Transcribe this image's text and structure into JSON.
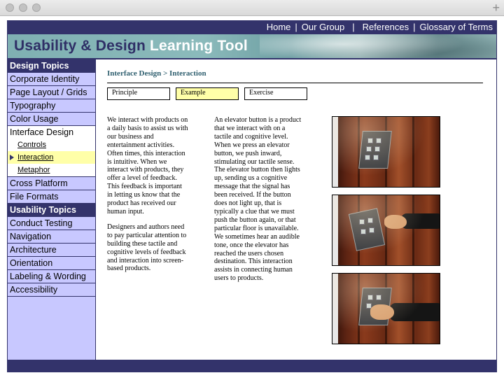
{
  "topnav": {
    "home": "Home",
    "our_group": "Our Group",
    "references": "References",
    "glossary": "Glossary of Terms",
    "sep": "|"
  },
  "banner": {
    "title_part1": "Usability & Design",
    "title_part2": "Learning Tool"
  },
  "sidebar": {
    "design_topics_heading": "Design Topics",
    "design_items": [
      "Corporate Identity",
      "Page Layout / Grids",
      "Typography",
      "Color Usage"
    ],
    "interface_design": "Interface Design",
    "sub_items": [
      "Controls",
      "Interaction",
      "Metaphor"
    ],
    "more_design_items": [
      "Cross Platform",
      "File Formats"
    ],
    "usability_topics_heading": "Usability Topics",
    "usability_items": [
      "Conduct Testing",
      "Navigation",
      "Architecture",
      "Orientation",
      "Labeling & Wording",
      "Accessibility"
    ]
  },
  "content": {
    "breadcrumb": "Interface Design > Interaction",
    "tabs": [
      "Principle",
      "Example",
      "Exercise"
    ],
    "selected_tab": "Example",
    "col1_p1": "We interact with products on a daily basis to assist us with our business and entertainment activities. Often times, this interaction is intuitive. When we interact with products, they offer a level of feedback. This feedback is important in letting us know that the product has received our human input.",
    "col1_p2": "Designers and authors need to pay particular attention to building these tactile and cognitive levels of feedback and interaction into screen-based products.",
    "col2_p1": "An elevator button is a product that we interact with on a tactile and cognitive level. When we press an elevator button, we push inward, stimulating our tactile sense. The elevator button then lights up, sending us a cognitive message that the signal has been received. If the button does not light up, that is typically a clue that we must push the button again, or that particular floor is unavailable. We sometimes hear an audible tone, once the elevator has reached the users chosen destination. This interaction assists in connecting human users to products."
  },
  "colors": {
    "navy": "#33336b",
    "sidebar_bg": "#c8c8ff",
    "highlight": "#ffffa8",
    "breadcrumb": "#2f5f6f",
    "banner_teal": "#7fb0b2"
  }
}
